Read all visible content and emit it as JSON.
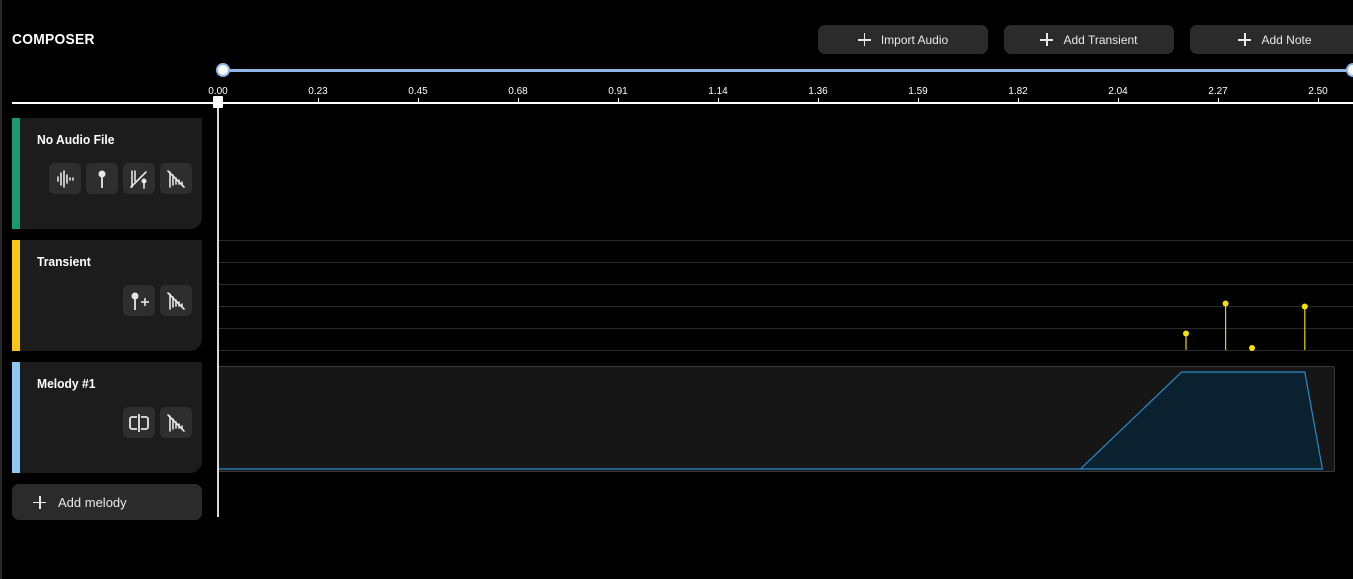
{
  "app": {
    "title": "COMPOSER"
  },
  "toolbar": {
    "import_audio": "Import Audio",
    "add_transient": "Add Transient",
    "add_note": "Add Note"
  },
  "timeline": {
    "ticks": [
      "0.00",
      "0.23",
      "0.45",
      "0.68",
      "0.91",
      "1.14",
      "1.36",
      "1.59",
      "1.82",
      "2.04",
      "2.27",
      "2.50"
    ],
    "range_start": 0.0,
    "range_end": 1.0,
    "playhead": "0.00"
  },
  "tracks": [
    {
      "label": "No Audio File",
      "color": "#1a9a6c",
      "icons": [
        "waveform-icon",
        "pin-icon",
        "pin-split-icon",
        "mute-icon"
      ]
    },
    {
      "label": "Transient",
      "color": "#f5c518",
      "icons": [
        "add-pin-icon",
        "mute-icon"
      ]
    },
    {
      "label": "Melody #1",
      "color": "#8cc9f0",
      "icons": [
        "split-icon",
        "mute-icon"
      ]
    }
  ],
  "melody_panel": {
    "add_label": "Add melody"
  },
  "transients": [
    {
      "time": 2.2,
      "level": 0.33
    },
    {
      "time": 2.29,
      "level": 0.93
    },
    {
      "time": 2.35,
      "level": 0.04
    },
    {
      "time": 2.47,
      "level": 0.87
    }
  ],
  "melody_envelope": {
    "points": [
      [
        0.0,
        0.0
      ],
      [
        1.96,
        0.0
      ],
      [
        2.19,
        1.0
      ],
      [
        2.47,
        1.0
      ],
      [
        2.51,
        0.0
      ]
    ],
    "color": "#2a8ac8"
  }
}
